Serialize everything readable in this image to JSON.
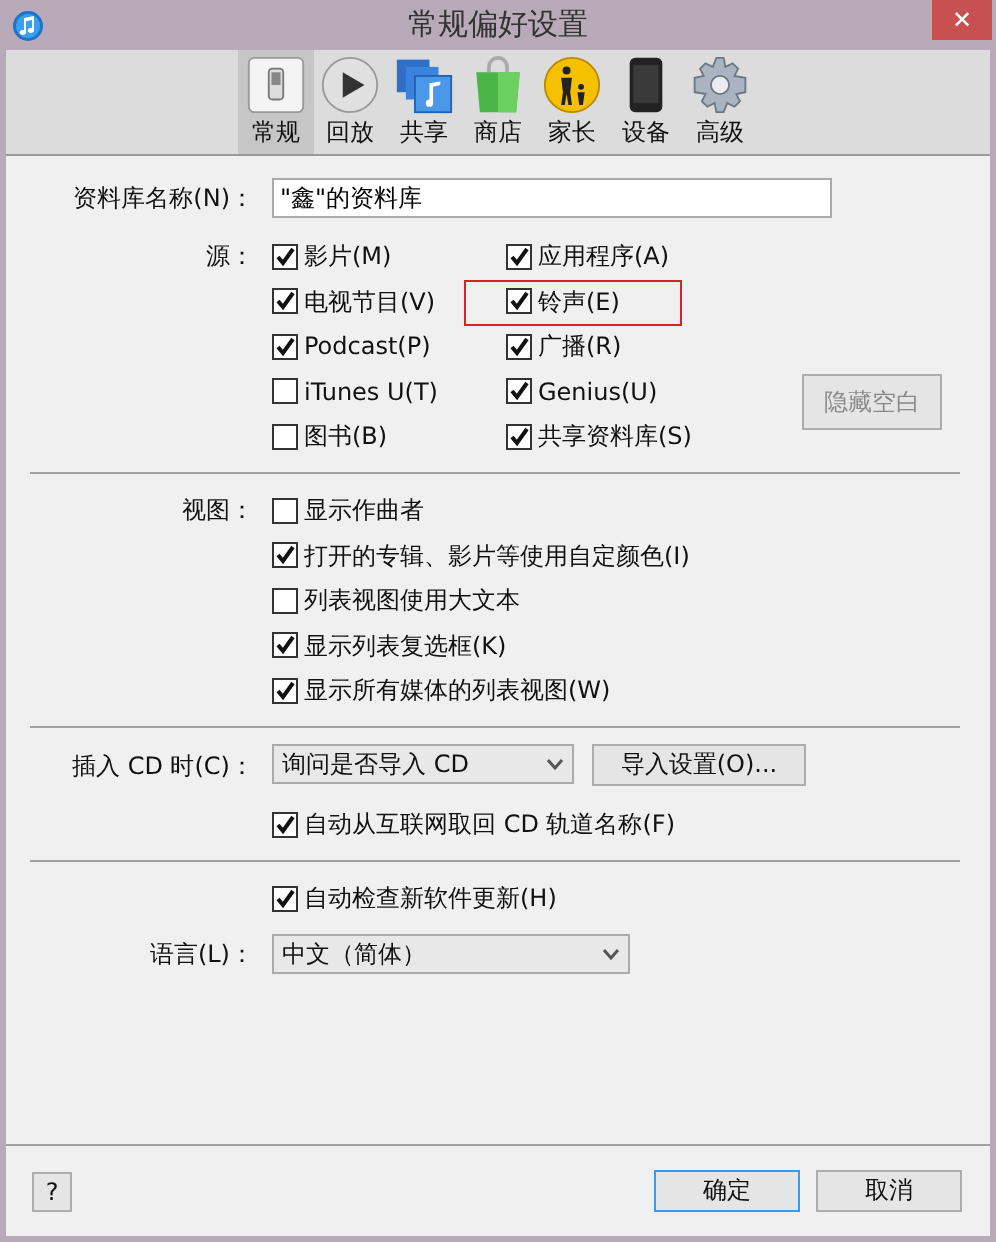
{
  "window": {
    "title": "常规偏好设置",
    "close": "✕"
  },
  "toolbar": [
    {
      "label": "常规",
      "selected": true
    },
    {
      "label": "回放",
      "selected": false
    },
    {
      "label": "共享",
      "selected": false
    },
    {
      "label": "商店",
      "selected": false
    },
    {
      "label": "家长",
      "selected": false
    },
    {
      "label": "设备",
      "selected": false
    },
    {
      "label": "高级",
      "selected": false
    }
  ],
  "library_name": {
    "label": "资料库名称(N)：",
    "value": "\"鑫\"的资料库"
  },
  "sources": {
    "label": "源：",
    "items": [
      {
        "label": "影片(M)",
        "checked": true,
        "highlighted": false
      },
      {
        "label": "应用程序(A)",
        "checked": true,
        "highlighted": false
      },
      {
        "label": "电视节目(V)",
        "checked": true,
        "highlighted": false
      },
      {
        "label": "铃声(E)",
        "checked": true,
        "highlighted": true
      },
      {
        "label": "Podcast(P)",
        "checked": true,
        "highlighted": false
      },
      {
        "label": "广播(R)",
        "checked": true,
        "highlighted": false
      },
      {
        "label": "iTunes U(T)",
        "checked": false,
        "highlighted": false
      },
      {
        "label": "Genius(U)",
        "checked": true,
        "highlighted": false
      },
      {
        "label": "图书(B)",
        "checked": false,
        "highlighted": false
      },
      {
        "label": "共享资料库(S)",
        "checked": true,
        "highlighted": false
      }
    ],
    "hide_button": {
      "label": "隐藏空白",
      "disabled": true
    }
  },
  "view": {
    "label": "视图：",
    "items": [
      {
        "label": "显示作曲者",
        "checked": false
      },
      {
        "label": "打开的专辑、影片等使用自定颜色(I)",
        "checked": true
      },
      {
        "label": "列表视图使用大文本",
        "checked": false
      },
      {
        "label": "显示列表复选框(K)",
        "checked": true
      },
      {
        "label": "显示所有媒体的列表视图(W)",
        "checked": true
      }
    ]
  },
  "cd": {
    "label": "插入 CD 时(C)：",
    "value": "询问是否导入 CD",
    "import_button": "导入设置(O)...",
    "fetch": {
      "label": "自动从互联网取回 CD 轨道名称(F)",
      "checked": true
    }
  },
  "update": {
    "label": "自动检查新软件更新(H)",
    "checked": true
  },
  "language": {
    "label": "语言(L)：",
    "value": "中文（简体）"
  },
  "footer": {
    "help": "?",
    "ok": "确定",
    "cancel": "取消"
  }
}
